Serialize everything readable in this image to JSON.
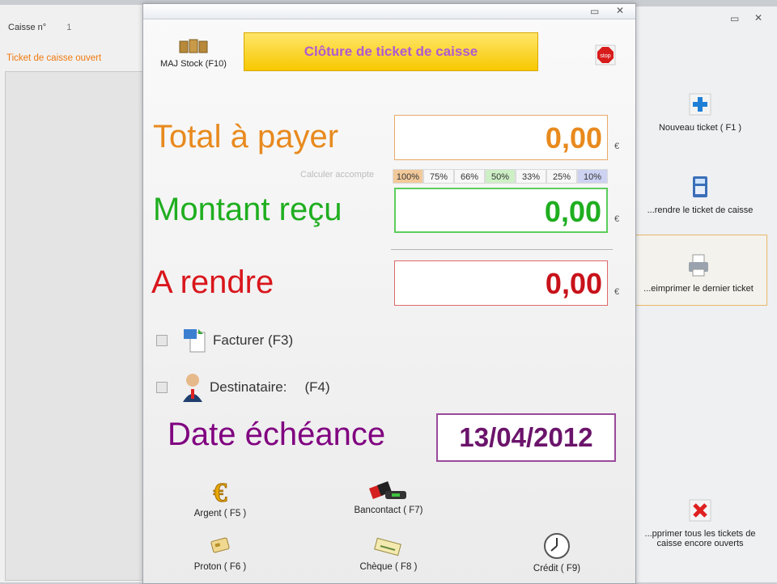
{
  "background_left": {
    "caisse_label": "Caisse n°",
    "caisse_number": "1",
    "ticket_open_label": "Ticket de caisse ouvert"
  },
  "background_right": {
    "new_ticket": "Nouveau ticket ( F1 )",
    "resume_ticket": "...rendre le ticket de caisse",
    "reprint_ticket": "...eimprimer le dernier ticket",
    "delete_all_line1": "...pprimer tous les tickets de",
    "delete_all_line2": "caisse encore ouverts"
  },
  "dialog": {
    "maj_stock_label": "MAJ Stock  (F10)",
    "title": "Clôture de ticket de caisse",
    "total_label": "Total à payer",
    "total_value": "0,00",
    "currency": "€",
    "acompte_label": "Calculer accompte",
    "percentages": [
      "100%",
      "75%",
      "66%",
      "50%",
      "33%",
      "25%",
      "10%"
    ],
    "received_label": "Montant reçu",
    "received_value": "0,00",
    "change_label": "A rendre",
    "change_value": "0,00",
    "invoice_label": "Facturer (F3)",
    "recipient_label": "Destinataire:",
    "recipient_key": "(F4)",
    "due_date_label": "Date échéance",
    "due_date_value": "13/04/2012",
    "payments": {
      "cash": "Argent ( F5 )",
      "bancontact": "Bancontact  ( F7)",
      "proton": "Proton  ( F6 )",
      "cheque": "Chèque    ( F8 )",
      "credit": "Crédit   ( F9)"
    }
  },
  "colors": {
    "total": "#e88a1e",
    "received": "#1fae1f",
    "change": "#d9161c",
    "due_date": "#800080",
    "title_text": "#b05ad0"
  },
  "icons": {
    "maj_stock": "stock-boxes-icon",
    "stop": "stop-icon",
    "new_ticket": "plus-icon",
    "resume_ticket": "cash-register-icon",
    "reprint": "printer-icon",
    "delete_all": "red-x-icon",
    "invoice": "invoice-icon",
    "recipient": "user-icon",
    "cash": "euro-icon",
    "bancontact": "card-terminal-icon",
    "proton": "proton-card-icon",
    "cheque": "cheque-icon",
    "credit": "clock-icon"
  }
}
